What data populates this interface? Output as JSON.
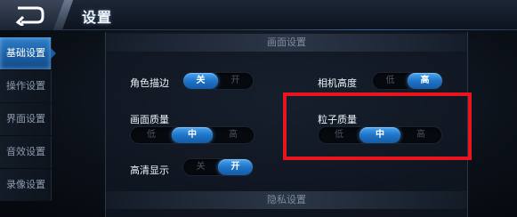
{
  "header": {
    "title": "设置"
  },
  "sidebar": {
    "items": [
      {
        "label": "基础设置",
        "active": true
      },
      {
        "label": "操作设置",
        "active": false
      },
      {
        "label": "界面设置",
        "active": false
      },
      {
        "label": "音效设置",
        "active": false
      },
      {
        "label": "录像设置",
        "active": false
      }
    ]
  },
  "sections": {
    "display": "画面设置",
    "privacy": "隐私设置"
  },
  "settings": {
    "outline": {
      "label": "角色描边",
      "options": [
        "关",
        "开"
      ],
      "selected": "关"
    },
    "camera_height": {
      "label": "相机高度",
      "options": [
        "低",
        "高"
      ],
      "selected": "高"
    },
    "graphics_quality": {
      "label": "画面质量",
      "options": [
        "低",
        "中",
        "高"
      ],
      "selected": "中"
    },
    "particle_quality": {
      "label": "粒子质量",
      "options": [
        "低",
        "中",
        "高"
      ],
      "selected": "中"
    },
    "hd_display": {
      "label": "高清显示",
      "options": [
        "关",
        "开"
      ],
      "selected": "开"
    }
  },
  "colors": {
    "accent": "#1f74c8",
    "highlight_box": "#e8141e"
  },
  "icons": {
    "back": "back-arrow-icon"
  }
}
